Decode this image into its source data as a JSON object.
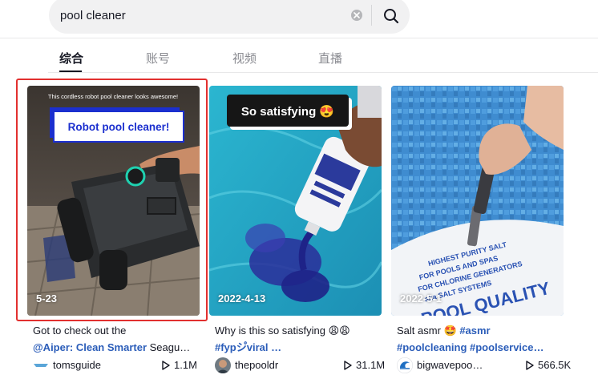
{
  "search": {
    "value": "pool cleaner"
  },
  "tabs": [
    {
      "label": "综合",
      "active": true
    },
    {
      "label": "账号",
      "active": false
    },
    {
      "label": "视频",
      "active": false
    },
    {
      "label": "直播",
      "active": false
    }
  ],
  "colors": {
    "highlight": "#e2302f",
    "hashtag": "#2b5db9"
  },
  "videos": [
    {
      "overlay_top": "This cordless robot pool cleaner looks awesome!",
      "overlay_title": "Robot pool cleaner!",
      "date": "5-23",
      "caption_line1": "Got to check out the",
      "caption_tag": "@Aiper: Clean Smarter",
      "caption_rest": " Seagu…",
      "author": "tomsguide",
      "views": "1.1M",
      "avatar_icon": "tomsguide-logo-icon"
    },
    {
      "overlay_title": "So satisfying 😍",
      "date": "2022-4-13",
      "caption_line1": "Why is this so satisfying 😩😩",
      "caption_tag": "#fypシ゚viral …",
      "author": "thepooldr",
      "views": "31.1M",
      "avatar_icon": "user-avatar-icon"
    },
    {
      "date": "2022-5-1",
      "caption_line1": "Salt asmr 🤩 ",
      "caption_line1_tag": "#asmr",
      "caption_tag": "#poolcleaning #poolservice…",
      "author": "bigwavepoo…",
      "views": "566.5K",
      "avatar_icon": "wave-logo-icon"
    }
  ]
}
